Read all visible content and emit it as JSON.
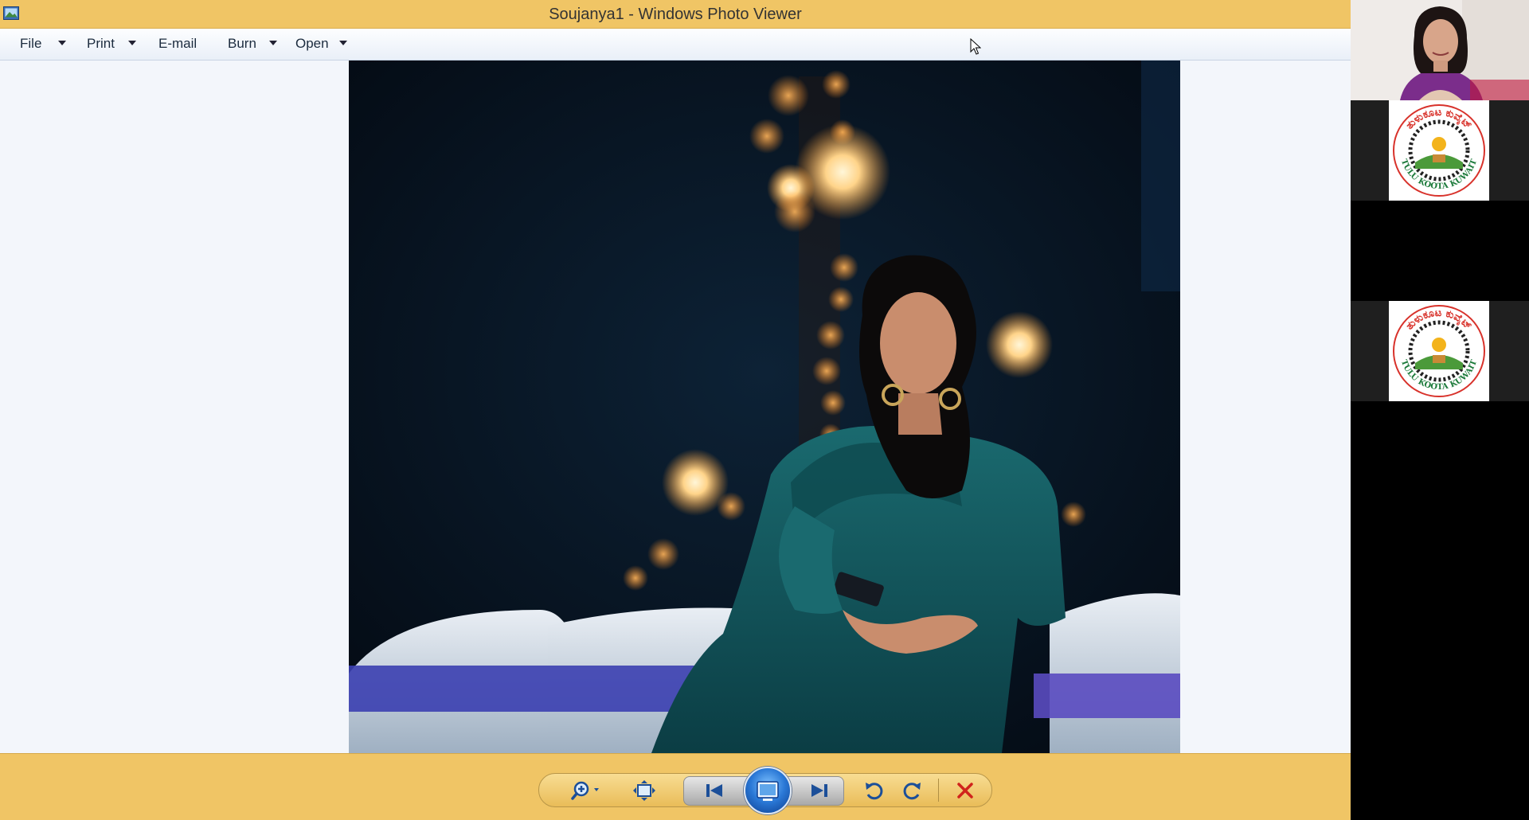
{
  "window": {
    "title": "Soujanya1 - Windows Photo Viewer"
  },
  "toolbar": {
    "file_label": "File",
    "print_label": "Print",
    "email_label": "E-mail",
    "burn_label": "Burn",
    "open_label": "Open"
  },
  "controls": {
    "zoom_icon": "magnifier-plus-icon",
    "actual_size_icon": "actual-size-icon",
    "previous_icon": "skip-previous-icon",
    "slideshow_icon": "slideshow-icon",
    "next_icon": "skip-next-icon",
    "rotate_ccw_icon": "rotate-counterclockwise-icon",
    "rotate_cw_icon": "rotate-clockwise-icon",
    "delete_icon": "red-x-delete-icon"
  },
  "meeting": {
    "logo_text_top": "ತುಳುಕೂಟ ಕುವೈಟ್",
    "logo_text_bottom": "TULU KOOTA KUWAIT"
  },
  "colors": {
    "title_bar": "#f0c565",
    "toolbar": "#e9eff8",
    "content_bg": "#f3f6fb",
    "logo_red": "#d8322b",
    "logo_green": "#1b7a3a",
    "delete_red": "#d0231c",
    "slideshow_blue": "#2a78d6"
  }
}
